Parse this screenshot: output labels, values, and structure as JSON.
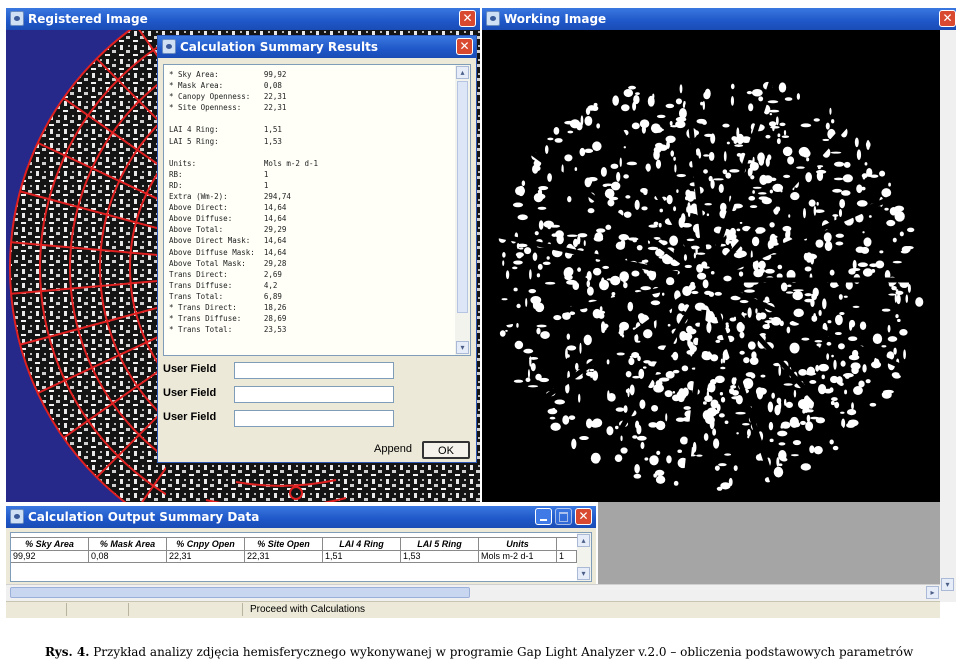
{
  "registered_window": {
    "title": "Registered Image"
  },
  "working_window": {
    "title": "Working Image"
  },
  "summary_dialog": {
    "title": "Calculation Summary Results",
    "lines": [
      "* Sky Area:          99,92",
      "* Mask Area:         0,08",
      "* Canopy Openness:   22,31",
      "* Site Openness:     22,31",
      "",
      "LAI 4 Ring:          1,51",
      "LAI 5 Ring:          1,53",
      "",
      "Units:               Mols m-2 d-1",
      "RB:                  1",
      "RD:                  1",
      "Extra (Wm-2):        294,74",
      "Above Direct:        14,64",
      "Above Diffuse:       14,64",
      "Above Total:         29,29",
      "Above Direct Mask:   14,64",
      "Above Diffuse Mask:  14,64",
      "Above Total Mask:    29,28",
      "Trans Direct:        2,69",
      "Trans Diffuse:       4,2",
      "Trans Total:         6,89",
      "* Trans Direct:      18,26",
      "* Trans Diffuse:     28,69",
      "* Trans Total:       23,53"
    ],
    "user_field_labels": [
      "User Field",
      "User Field",
      "User Field"
    ],
    "append_label": "Append",
    "ok_label": "OK"
  },
  "output_window": {
    "title": "Calculation Output Summary Data",
    "columns": [
      "% Sky Area",
      "% Mask Area",
      "% Cnpy Open",
      "% Site Open",
      "LAI 4 Ring",
      "LAI 5 Ring",
      "Units"
    ],
    "row": [
      "99,92",
      "0,08",
      "22,31",
      "22,31",
      "1,51",
      "1,53",
      "Mols m-2 d-1",
      "1"
    ]
  },
  "status_bar": {
    "text": "Proceed with Calculations"
  },
  "caption": {
    "prefix": "Rys. 4.",
    "text": "Przykład analizy zdjęcia hemisferycznego wykonywanej w programie Gap Light Analyzer v.2.0 – obliczenia podstawowych parametrów"
  },
  "colors": {
    "titlebar": "#1f57c8",
    "desktop": "#2a2e8a",
    "grid": "#e02020",
    "close": "#d8492f"
  }
}
